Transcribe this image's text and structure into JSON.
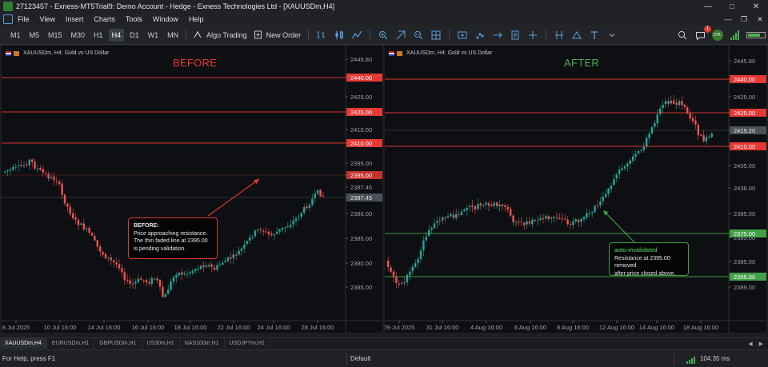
{
  "titlebar": {
    "text": "27123457 - Exness-MT5Trial9: Demo Account - Hedge - Exness Technologies Ltd - [XAUUSDm,H4]"
  },
  "menu": {
    "items": [
      "File",
      "View",
      "Insert",
      "Charts",
      "Tools",
      "Window",
      "Help"
    ]
  },
  "toolbar": {
    "timeframes": [
      "M1",
      "M5",
      "M15",
      "M30",
      "H1",
      "H4",
      "D1",
      "W1",
      "MN"
    ],
    "active_timeframe": "H4",
    "algo_label": "Algo Trading",
    "neworder_label": "New Order",
    "notif_count": "1",
    "avatar_text": "DYL"
  },
  "colors": {
    "background": "#0e0f12",
    "bull": "#26a69a",
    "bear": "#ef5350",
    "resistance": "#e53935",
    "support": "#43a047",
    "price_tag": "#4b5058",
    "before_heading": "#e53935",
    "after_heading": "#4caf50"
  },
  "chart_data": [
    {
      "type": "candlestick",
      "heading": "BEFORE",
      "symbol": "XAUUSDm, H4:  Gold vs US Dollar",
      "y_ticks": [
        "2445.80",
        "2440.00",
        "2425.00",
        "2435.00",
        "2410.00",
        "2405.00",
        "2395.00",
        "2385.00",
        "2387.45",
        "2336.00",
        "2386.00",
        "2385.00",
        "2380.00",
        "2385.00"
      ],
      "x_ticks": [
        "8 Jul 2025",
        "10 Jul 16:00",
        "14 Jul 16:00",
        "16 Jul 16:00",
        "18 Jul 16:00",
        "22 Jul 16:00",
        "24 Jul 16:00",
        "28 Jul 16:00"
      ],
      "levels": [
        {
          "label": "2440.00",
          "kind": "resistance",
          "style": "solid"
        },
        {
          "label": "2425.00",
          "kind": "resistance",
          "style": "solid"
        },
        {
          "label": "2410.00",
          "kind": "resistance",
          "style": "solid"
        },
        {
          "label": "2395.00",
          "kind": "resistance",
          "style": "faded"
        }
      ],
      "current_price": "2387.45",
      "callout": {
        "title": "BEFORE:",
        "lines": [
          "Price approaching resistance.",
          "The thin faded line at 2395.00",
          "is pending validation."
        ]
      }
    },
    {
      "type": "candlestick",
      "heading": "AFTER",
      "symbol": "XAUUSDm, H4:  Gold vs US Dollar",
      "y_ticks": [
        "2445.80",
        "2440.00",
        "2425.00",
        "2435.00",
        "2419.20",
        "2410.00",
        "2405.00",
        "2436.00",
        "2385.00",
        "2335.00",
        "2385.00",
        "2385.00",
        "2355.00",
        "2389.00"
      ],
      "x_ticks": [
        "29 Jul 2025",
        "31 Jul 16:00",
        "4 Aug 16:00",
        "6 Aug 16:00",
        "8 Aug 16:00",
        "12 Aug 16:00",
        "14 Aug 16:00",
        "18 Aug 16:00"
      ],
      "levels": [
        {
          "label": "2440.00",
          "kind": "resistance",
          "style": "solid"
        },
        {
          "label": "2425.00",
          "kind": "resistance",
          "style": "solid"
        },
        {
          "label": "2410.00",
          "kind": "resistance",
          "style": "solid"
        },
        {
          "label": "2375.00",
          "kind": "support",
          "style": "solid"
        },
        {
          "label": "2355.00",
          "kind": "support",
          "style": "solid"
        }
      ],
      "current_price": "2419.20",
      "callout": {
        "title": "auto-invalidated",
        "lines": [
          "Resistance at 2395.00 removed",
          "after price closed above."
        ]
      }
    }
  ],
  "tabs": {
    "items": [
      "XAUUSDm,H4",
      "EURUSDm,H1",
      "GBPUSDm,H1",
      "US30m,H1",
      "NAS100m,H1",
      "USDJPYm,H1"
    ],
    "active": "XAUUSDm,H4"
  },
  "status": {
    "help": "For Help, press F1",
    "profile": "Default",
    "ping": "104.35 ms"
  }
}
